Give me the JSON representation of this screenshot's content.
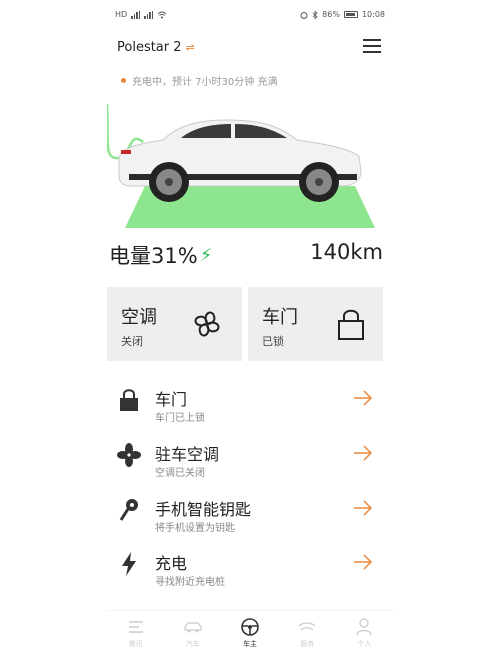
{
  "statusbar": {
    "left": "HD",
    "battery_percent": "86%",
    "time": "10:08"
  },
  "header": {
    "model": "Polestar 2",
    "swap_icon": "swap-icon",
    "menu_icon": "hamburger-menu-icon"
  },
  "charging_status": "充电中，预计 7小时30分钟 充满",
  "metrics": {
    "battery_label": "电量31%",
    "battery_level": 0.31,
    "range": "140km"
  },
  "tiles": [
    {
      "title": "空调",
      "sub": "关闭",
      "icon": "fan-icon"
    },
    {
      "title": "车门",
      "sub": "已锁",
      "icon": "lock-icon"
    }
  ],
  "list": [
    {
      "title": "车门",
      "sub": "车门已上锁",
      "icon": "lock-icon"
    },
    {
      "title": "驻车空调",
      "sub": "空调已关闭",
      "icon": "fan-icon"
    },
    {
      "title": "手机智能钥匙",
      "sub": "将手机设置为钥匙",
      "icon": "key-icon"
    },
    {
      "title": "充电",
      "sub": "寻找附近充电桩",
      "icon": "bolt-icon"
    }
  ],
  "nav": [
    {
      "label": "資讯",
      "icon": "news-icon"
    },
    {
      "label": "汽车",
      "icon": "car-icon"
    },
    {
      "label": "车主",
      "icon": "steering-wheel-icon"
    },
    {
      "label": "服务",
      "icon": "service-icon"
    },
    {
      "label": "个人",
      "icon": "person-icon"
    }
  ],
  "colors": {
    "accent": "#e8883d",
    "charge_green": "#2ebf5c",
    "tile_bg": "#eeeeee"
  }
}
